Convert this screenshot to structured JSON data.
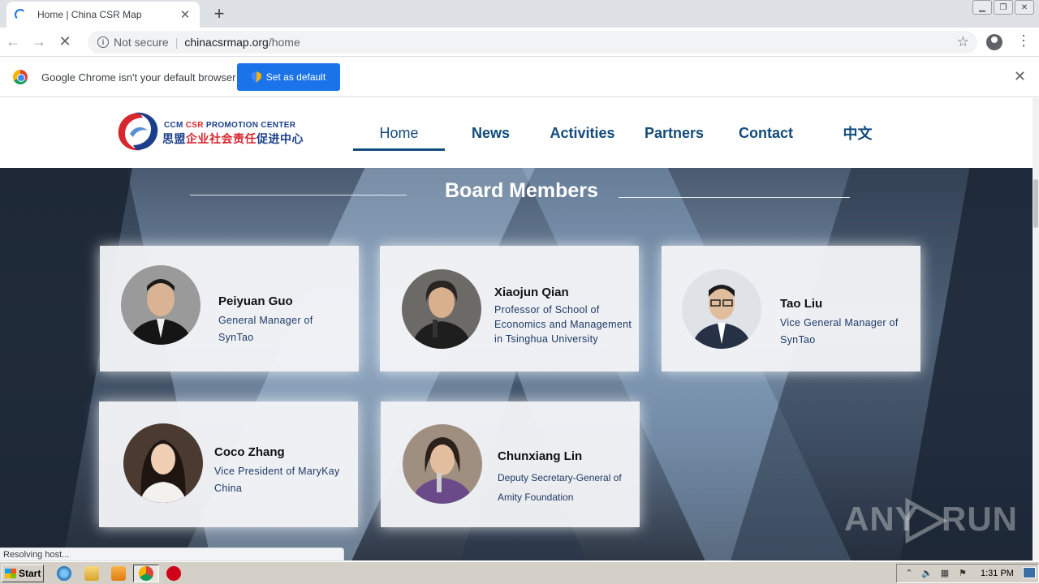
{
  "browser": {
    "tab_title": "Home | China CSR Map",
    "new_tab_symbol": "+",
    "close_symbol": "✕",
    "security_label": "Not secure",
    "url_host": "chinacsrmap.org",
    "url_path": "/home",
    "infobar_message": "Google Chrome isn't your default browser",
    "infobar_button": "Set as default",
    "status_text": "Resolving host..."
  },
  "site": {
    "logo_en_prefix": "CCM ",
    "logo_en_csr": "CSR",
    "logo_en_suffix": " PROMOTION CENTER",
    "logo_cn_blue": "思盟",
    "logo_cn_red": "企业社会责任",
    "logo_cn_blue2": "促进中心",
    "nav": [
      {
        "label": "Home"
      },
      {
        "label": "News"
      },
      {
        "label": "Activities"
      },
      {
        "label": "Partners"
      },
      {
        "label": "Contact"
      },
      {
        "label": "中文"
      }
    ],
    "section_title": "Board Members",
    "members": [
      {
        "name": "Peiyuan Guo",
        "role": "General Manager of SynTao"
      },
      {
        "name": "Xiaojun Qian",
        "role": "Professor of School of Economics and Management in Tsinghua University"
      },
      {
        "name": "Tao Liu",
        "role": "Vice General Manager of SynTao"
      },
      {
        "name": "Coco Zhang",
        "role": "Vice President of MaryKay China"
      },
      {
        "name": "Chunxiang Lin",
        "role": "Deputy Secretary-General of Amity Foundation"
      }
    ]
  },
  "watermark": {
    "left": "ANY",
    "right": "RUN"
  },
  "taskbar": {
    "start_label": "Start",
    "clock": "1:31 PM"
  }
}
